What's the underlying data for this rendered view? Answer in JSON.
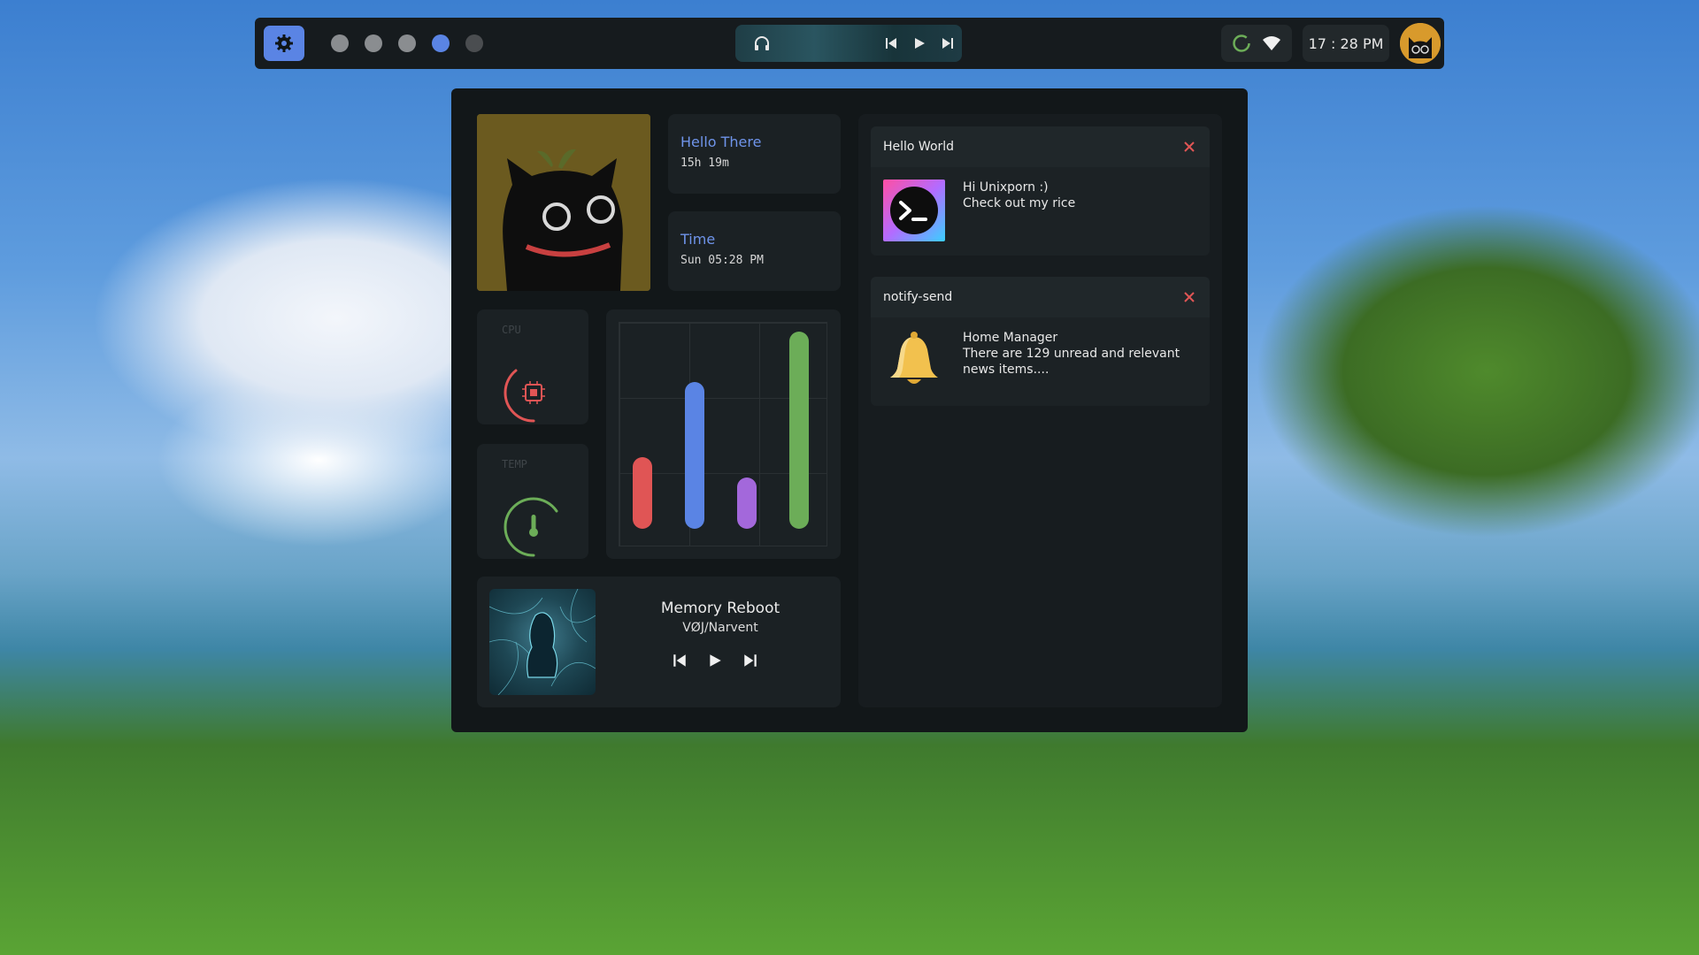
{
  "topbar": {
    "app_icon": "gear-icon",
    "workspaces": [
      {
        "state": "occupied"
      },
      {
        "state": "occupied"
      },
      {
        "state": "occupied"
      },
      {
        "state": "active"
      },
      {
        "state": "empty"
      }
    ],
    "media_icons": [
      "headphones-icon",
      "skip-previous-icon",
      "play-icon",
      "skip-next-icon"
    ],
    "status_icons": [
      "network-ring-icon",
      "wifi-icon"
    ],
    "clock": "17 : 28 PM",
    "avatar": "cat-avatar"
  },
  "dashboard": {
    "greeting": {
      "title": "Hello There",
      "value": "15h 19m"
    },
    "time": {
      "title": "Time",
      "value": "Sun 05:28 PM"
    },
    "cpu": {
      "label": "CPU",
      "level": 0.25
    },
    "temp": {
      "label": "TEMP",
      "level": 0.5
    },
    "music": {
      "title": "Memory Reboot",
      "artist": "VØJ/Narvent"
    },
    "resource_graph": {
      "bars": [
        {
          "value": 0.35,
          "color": "#e05555"
        },
        {
          "value": 0.72,
          "color": "#5a84e4"
        },
        {
          "value": 0.25,
          "color": "#a368db"
        },
        {
          "value": 0.97,
          "color": "#6cad58"
        }
      ]
    },
    "notifications": [
      {
        "app": "Hello World",
        "title": "Hi Unixporn :)",
        "body": "Check out my rice",
        "icon": "terminal-icon"
      },
      {
        "app": "notify-send",
        "title": "Home Manager",
        "body_lines": [
          "There are 129 unread and relevant",
          "news items...."
        ],
        "icon": "bell-icon"
      }
    ]
  },
  "colors": {
    "accent": "#5a84e4",
    "red": "#e05555",
    "green": "#6cad58",
    "purple": "#a368db"
  }
}
